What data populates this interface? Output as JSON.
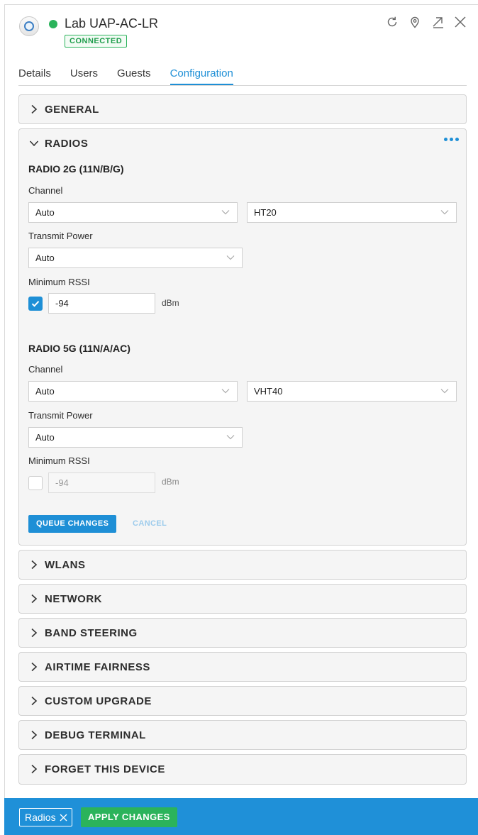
{
  "header": {
    "device_name": "Lab UAP-AC-LR",
    "status_badge": "CONNECTED",
    "icons": [
      "refresh-icon",
      "locate-icon",
      "popout-icon",
      "close-icon"
    ]
  },
  "tabs": [
    {
      "label": "Details",
      "active": false
    },
    {
      "label": "Users",
      "active": false
    },
    {
      "label": "Guests",
      "active": false
    },
    {
      "label": "Configuration",
      "active": true
    }
  ],
  "sections": {
    "general": "GENERAL",
    "radios": "RADIOS",
    "wlans": "WLANS",
    "network": "NETWORK",
    "band_steering": "BAND STEERING",
    "airtime_fairness": "AIRTIME FAIRNESS",
    "custom_upgrade": "CUSTOM UPGRADE",
    "debug_terminal": "DEBUG TERMINAL",
    "forget_device": "FORGET THIS DEVICE"
  },
  "radio_2g": {
    "title": "RADIO 2G (11N/B/G)",
    "channel_label": "Channel",
    "channel_value": "Auto",
    "width_value": "HT20",
    "power_label": "Transmit Power",
    "power_value": "Auto",
    "rssi_label": "Minimum RSSI",
    "rssi_enabled": true,
    "rssi_value": "-94",
    "rssi_unit": "dBm"
  },
  "radio_5g": {
    "title": "RADIO 5G (11N/A/AC)",
    "channel_label": "Channel",
    "channel_value": "Auto",
    "width_value": "VHT40",
    "power_label": "Transmit Power",
    "power_value": "Auto",
    "rssi_label": "Minimum RSSI",
    "rssi_enabled": false,
    "rssi_value": "-94",
    "rssi_unit": "dBm"
  },
  "actions": {
    "queue": "QUEUE CHANGES",
    "cancel": "CANCEL"
  },
  "bottom_bar": {
    "chip_label": "Radios",
    "apply": "APPLY CHANGES"
  },
  "colors": {
    "accent": "#1e8fd6",
    "success": "#2bb35b",
    "panel_bg": "#f5f5f5"
  }
}
